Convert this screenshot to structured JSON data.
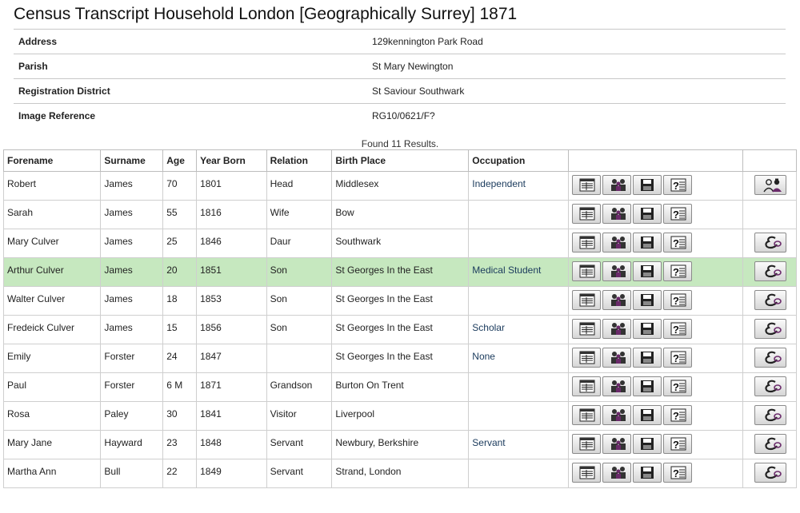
{
  "page": {
    "title": "Census Transcript Household London [Geographically Surrey] 1871"
  },
  "details": [
    {
      "label": "Address",
      "value": "129kennington Park Road"
    },
    {
      "label": "Parish",
      "value": "St Mary Newington"
    },
    {
      "label": "Registration District",
      "value": "St Saviour Southwark"
    },
    {
      "label": "Image Reference",
      "value": "RG10/0621/F?"
    }
  ],
  "results_text": "Found 11 Results.",
  "columns": [
    "Forename",
    "Surname",
    "Age",
    "Year Born",
    "Relation",
    "Birth Place",
    "Occupation"
  ],
  "rows": [
    {
      "forename": "Robert",
      "surname": "James",
      "age": "70",
      "year_born": "1801",
      "relation": "Head",
      "birth_place": "Middlesex",
      "occupation": "Independent",
      "extra": "family-tree"
    },
    {
      "forename": "Sarah",
      "surname": "James",
      "age": "55",
      "year_born": "1816",
      "relation": "Wife",
      "birth_place": "Bow",
      "occupation": "",
      "extra": "none"
    },
    {
      "forename": "Mary Culver",
      "surname": "James",
      "age": "25",
      "year_born": "1846",
      "relation": "Daur",
      "birth_place": "Southwark",
      "occupation": "",
      "extra": "marriage"
    },
    {
      "forename": "Arthur Culver",
      "surname": "James",
      "age": "20",
      "year_born": "1851",
      "relation": "Son",
      "birth_place": "St Georges In the East",
      "occupation": "Medical Student",
      "extra": "marriage",
      "highlighted": true
    },
    {
      "forename": "Walter Culver",
      "surname": "James",
      "age": "18",
      "year_born": "1853",
      "relation": "Son",
      "birth_place": "St Georges In the East",
      "occupation": "",
      "extra": "marriage"
    },
    {
      "forename": "Fredeick Culver",
      "surname": "James",
      "age": "15",
      "year_born": "1856",
      "relation": "Son",
      "birth_place": "St Georges In the East",
      "occupation": "Scholar",
      "extra": "marriage"
    },
    {
      "forename": "Emily",
      "surname": "Forster",
      "age": "24",
      "year_born": "1847",
      "relation": "",
      "birth_place": "St Georges In the East",
      "occupation": "None",
      "extra": "marriage"
    },
    {
      "forename": "Paul",
      "surname": "Forster",
      "age": "6 M",
      "year_born": "1871",
      "relation": "Grandson",
      "birth_place": "Burton On Trent",
      "occupation": "",
      "extra": "marriage"
    },
    {
      "forename": "Rosa",
      "surname": "Paley",
      "age": "30",
      "year_born": "1841",
      "relation": "Visitor",
      "birth_place": "Liverpool",
      "occupation": "",
      "extra": "marriage"
    },
    {
      "forename": "Mary Jane",
      "surname": "Hayward",
      "age": "23",
      "year_born": "1848",
      "relation": "Servant",
      "birth_place": "Newbury, Berkshire",
      "occupation": "Servant",
      "extra": "marriage"
    },
    {
      "forename": "Martha Ann",
      "surname": "Bull",
      "age": "22",
      "year_born": "1849",
      "relation": "Servant",
      "birth_place": "Strand, London",
      "occupation": "",
      "extra": "marriage"
    }
  ],
  "row_actions": [
    "transcript-icon",
    "household-icon",
    "save-icon",
    "query-icon"
  ],
  "colors": {
    "highlight": "#c6e8bf",
    "occupation": "#1a3a5c",
    "icon_purple": "#6a2a6a"
  }
}
